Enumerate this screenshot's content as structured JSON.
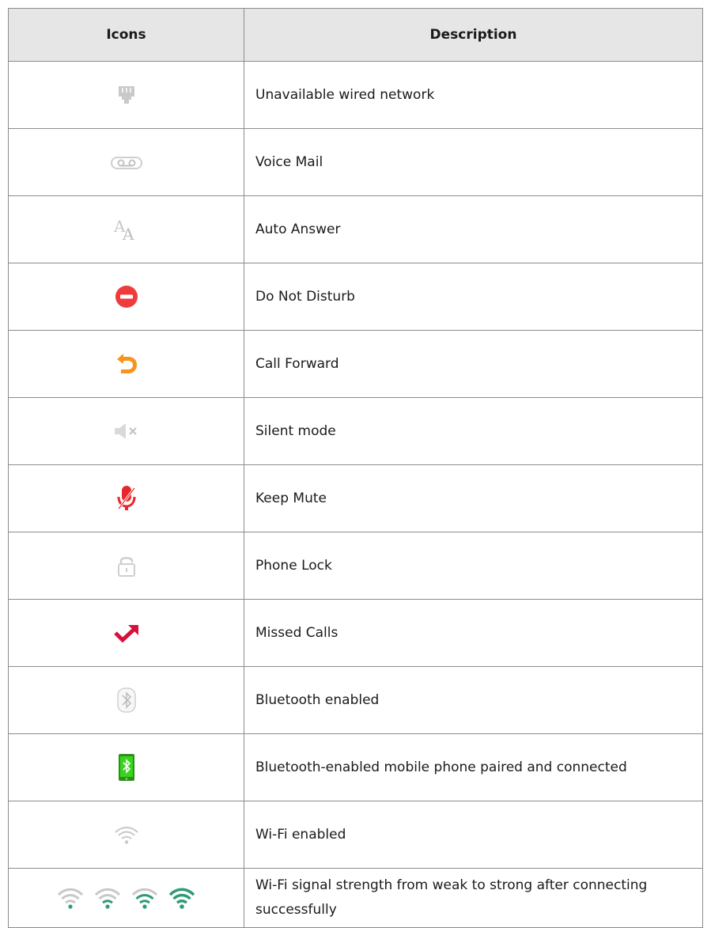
{
  "table": {
    "headers": {
      "icons": "Icons",
      "description": "Description"
    },
    "rows": [
      {
        "icon": "unavailable-wired-network-icon",
        "description": "Unavailable wired network"
      },
      {
        "icon": "voicemail-icon",
        "description": "Voice Mail"
      },
      {
        "icon": "auto-answer-icon",
        "description": "Auto Answer"
      },
      {
        "icon": "do-not-disturb-icon",
        "description": "Do Not Disturb"
      },
      {
        "icon": "call-forward-icon",
        "description": "Call Forward"
      },
      {
        "icon": "silent-mode-icon",
        "description": "Silent mode"
      },
      {
        "icon": "keep-mute-icon",
        "description": "Keep Mute"
      },
      {
        "icon": "phone-lock-icon",
        "description": "Phone Lock"
      },
      {
        "icon": "missed-calls-icon",
        "description": "Missed Calls"
      },
      {
        "icon": "bluetooth-enabled-icon",
        "description": "Bluetooth enabled"
      },
      {
        "icon": "bluetooth-mobile-paired-icon",
        "description": "Bluetooth-enabled mobile phone paired and connected"
      },
      {
        "icon": "wifi-enabled-icon",
        "description": "Wi-Fi enabled"
      },
      {
        "icon": "wifi-signal-strength-icons",
        "description": "Wi-Fi signal strength from weak to strong after connecting successfully"
      }
    ]
  },
  "colors": {
    "header_bg": "#e6e6e6",
    "border": "#8c8c8c",
    "dnd_red": "#ef3b3b",
    "forward_orange": "#f7941d",
    "mute_red": "#e8272b",
    "missed_red": "#d6123c",
    "bt_green": "#39d41e",
    "wifi_green": "#2e9b73",
    "icon_gray": "#c8c8c8"
  }
}
